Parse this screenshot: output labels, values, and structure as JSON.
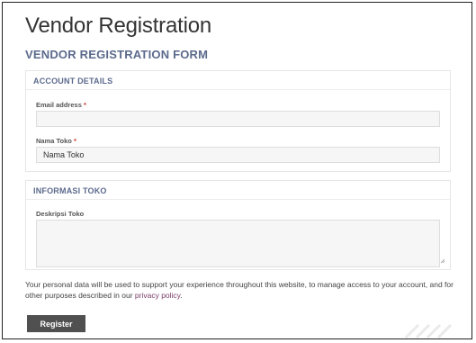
{
  "page": {
    "title": "Vendor Registration",
    "form_title": "VENDOR REGISTRATION FORM"
  },
  "account": {
    "title": "ACCOUNT DETAILS",
    "email_label": "Email address",
    "email_value": "",
    "store_name_label": "Nama Toko",
    "store_name_value": "Nama Toko",
    "required_mark": "*"
  },
  "store_info": {
    "title": "INFORMASI TOKO",
    "description_label": "Deskripsi Toko",
    "description_value": ""
  },
  "privacy": {
    "text_before": "Your personal data will be used to support your experience throughout this website, to manage access to your account, and for other purposes described in our ",
    "link_text": "privacy policy",
    "text_after": "."
  },
  "actions": {
    "register_label": "Register"
  },
  "colors": {
    "section_title": "#5b6a8c",
    "required": "#c0392b",
    "link": "#7a3f6b",
    "button_bg": "#505050"
  },
  "icons": {
    "textarea_resize": "resize-handle-icon"
  }
}
